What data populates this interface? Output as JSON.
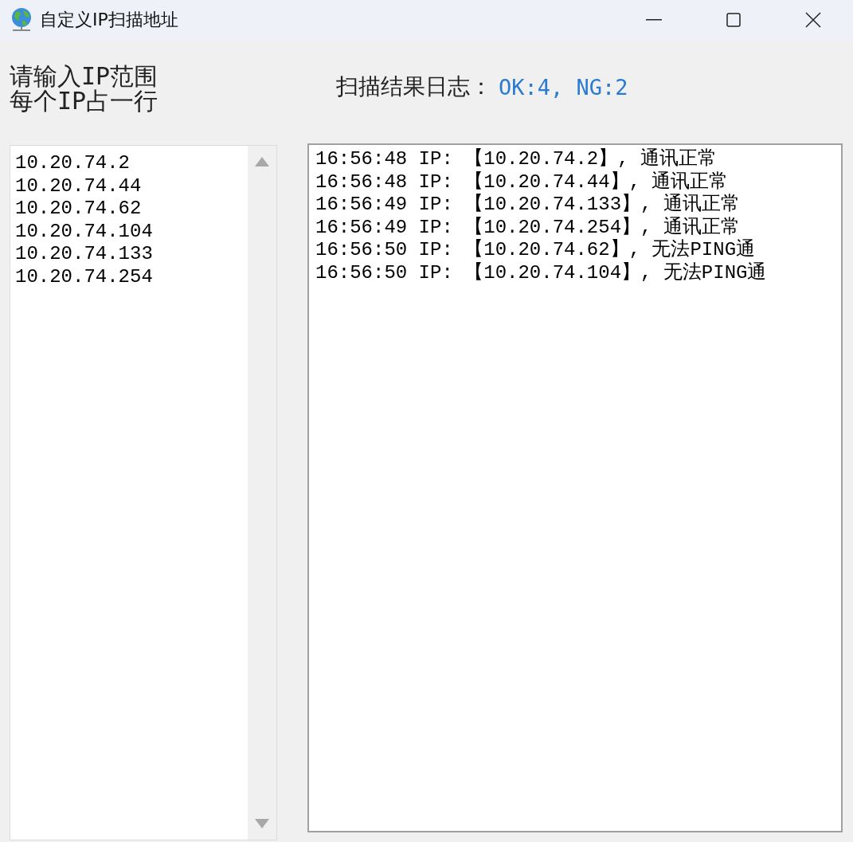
{
  "window": {
    "title": "自定义IP扫描地址"
  },
  "input_label": [
    "请输入IP范围",
    "每个IP占一行"
  ],
  "ip_list": [
    "10.20.74.2",
    "10.20.74.44",
    "10.20.74.62",
    "10.20.74.104",
    "10.20.74.133",
    "10.20.74.254"
  ],
  "log_label": "扫描结果日志：",
  "log_summary": "OK:4, NG:2",
  "log_lines": [
    "16:56:48 IP: 【10.20.74.2】, 通讯正常",
    "16:56:48 IP: 【10.20.74.44】, 通讯正常",
    "16:56:49 IP: 【10.20.74.133】, 通讯正常",
    "16:56:49 IP: 【10.20.74.254】, 通讯正常",
    "16:56:50 IP: 【10.20.74.62】, 无法PING通",
    "16:56:50 IP: 【10.20.74.104】, 无法PING通"
  ]
}
